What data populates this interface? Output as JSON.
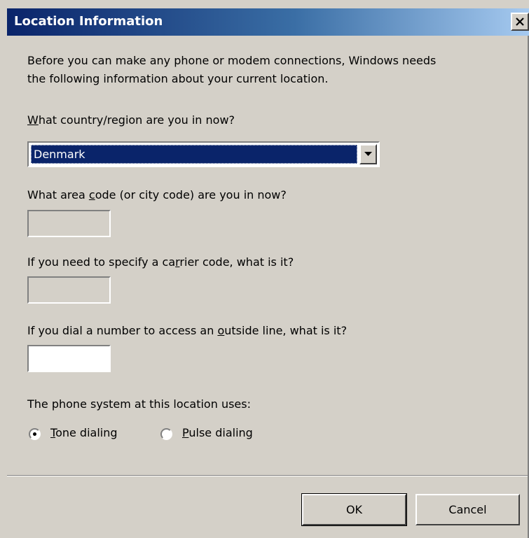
{
  "window": {
    "title": "Location Information",
    "close_glyph": "×"
  },
  "intro": {
    "line1": "Before you can make any phone or modem connections, Windows needs",
    "line2": "the following information about your current location."
  },
  "country": {
    "label_accel": "W",
    "label_rest": "hat country/region are you in now?",
    "selected": "Denmark"
  },
  "area_code": {
    "label_pre": "What area ",
    "label_accel": "c",
    "label_post": "ode (or city code) are you in now?",
    "value": "",
    "enabled": false
  },
  "carrier_code": {
    "label_pre": "If you need to specify a ca",
    "label_accel": "r",
    "label_post": "rier code, what is it?",
    "value": "",
    "enabled": false
  },
  "outside_line": {
    "label_pre": "If you dial a number to access an ",
    "label_accel": "o",
    "label_post": "utside line, what is it?",
    "value": "",
    "enabled": true
  },
  "phone_system": {
    "label": "The phone system at this location uses:",
    "tone_accel": "T",
    "tone_rest": "one dialing",
    "pulse_accel": "P",
    "pulse_rest": "ulse dialing",
    "selected": "tone"
  },
  "buttons": {
    "ok": "OK",
    "cancel": "Cancel"
  }
}
